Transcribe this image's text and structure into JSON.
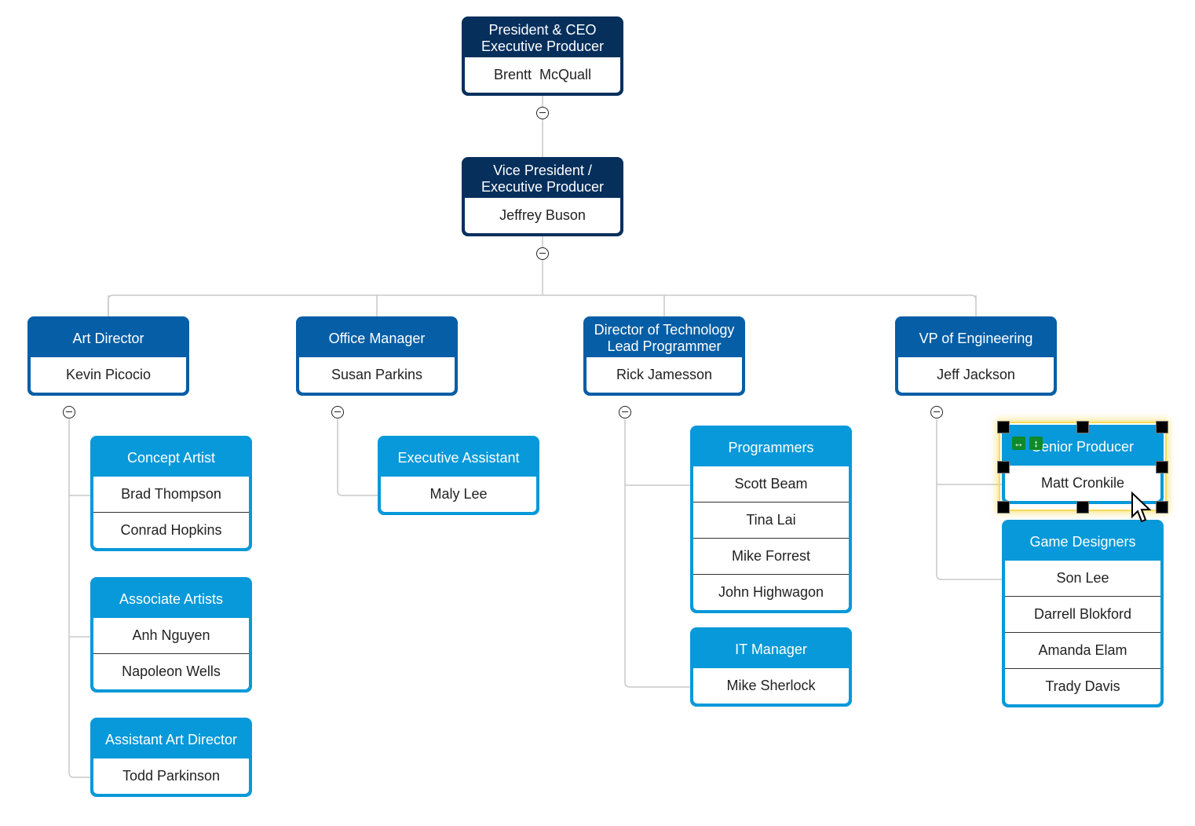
{
  "chart": {
    "colors": {
      "level0": "#062f5c",
      "level1": "#055ea6",
      "level2": "#0799d9",
      "connector": "#c8c8c8",
      "selection": "#f5dc5a",
      "handle": "#000000",
      "resize_badge": "#0e8a2a"
    },
    "nodes": {
      "ceo": {
        "title": "President & CEO Executive Producer",
        "members": [
          "Brentt  McQuall"
        ]
      },
      "vp": {
        "title": "Vice President / Executive Producer",
        "members": [
          "Jeffrey Buson"
        ]
      },
      "art_director": {
        "title": "Art Director",
        "members": [
          "Kevin Picocio"
        ]
      },
      "office_manager": {
        "title": "Office Manager",
        "members": [
          "Susan Parkins"
        ]
      },
      "dir_tech": {
        "title": "Director of Technology Lead Programmer",
        "members": [
          "Rick Jamesson"
        ]
      },
      "vp_eng": {
        "title": "VP of Engineering",
        "members": [
          "Jeff Jackson"
        ]
      },
      "concept_artist": {
        "title": "Concept Artist",
        "members": [
          "Brad Thompson",
          "Conrad Hopkins"
        ]
      },
      "associate_artists": {
        "title": "Associate Artists",
        "members": [
          "Anh Nguyen",
          "Napoleon Wells"
        ]
      },
      "asst_art_director": {
        "title": "Assistant Art Director",
        "members": [
          "Todd Parkinson"
        ]
      },
      "exec_assistant": {
        "title": "Executive Assistant",
        "members": [
          "Maly Lee"
        ]
      },
      "programmers": {
        "title": "Programmers",
        "members": [
          "Scott Beam",
          "Tina Lai",
          "Mike Forrest",
          "John Highwagon"
        ]
      },
      "it_manager": {
        "title": "IT Manager",
        "members": [
          "Mike Sherlock"
        ]
      },
      "senior_producer": {
        "title": "Senior Producer",
        "members": [
          "Matt Cronkile"
        ],
        "selected": true
      },
      "game_designers": {
        "title": "Game Designers",
        "members": [
          "Son Lee",
          "Darrell Blokford",
          "Amanda Elam",
          "Trady Davis"
        ]
      }
    },
    "edges": [
      [
        "ceo",
        "vp"
      ],
      [
        "vp",
        "art_director"
      ],
      [
        "vp",
        "office_manager"
      ],
      [
        "vp",
        "dir_tech"
      ],
      [
        "vp",
        "vp_eng"
      ],
      [
        "art_director",
        "concept_artist"
      ],
      [
        "art_director",
        "associate_artists"
      ],
      [
        "art_director",
        "asst_art_director"
      ],
      [
        "office_manager",
        "exec_assistant"
      ],
      [
        "dir_tech",
        "programmers"
      ],
      [
        "dir_tech",
        "it_manager"
      ],
      [
        "vp_eng",
        "senior_producer"
      ],
      [
        "vp_eng",
        "game_designers"
      ]
    ],
    "icons": {
      "collapse": "collapse-minus-icon",
      "resize_horizontal": "↔",
      "resize_vertical": "↕",
      "cursor": "mouse-pointer-icon"
    }
  }
}
